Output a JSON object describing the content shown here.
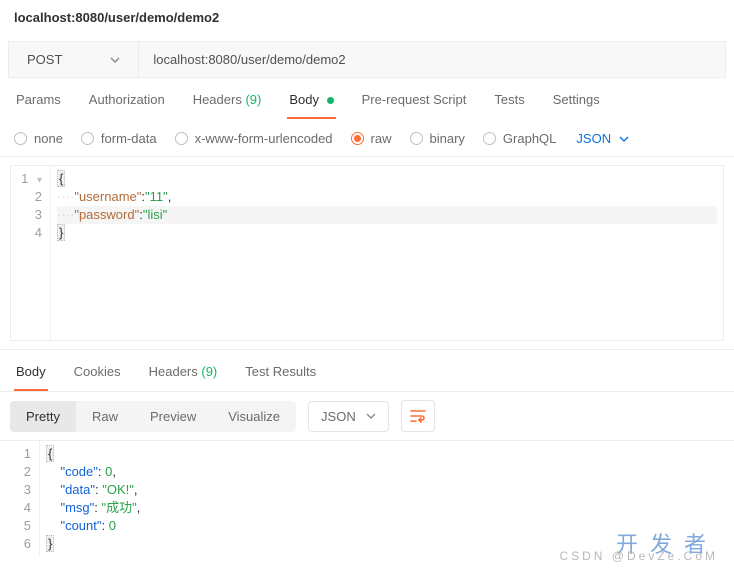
{
  "topbar": {
    "title": "localhost:8080/user/demo/demo2"
  },
  "request": {
    "method": "POST",
    "url": "localhost:8080/user/demo/demo2"
  },
  "tabs": {
    "params": "Params",
    "auth": "Authorization",
    "headers": "Headers",
    "headers_count": "(9)",
    "body": "Body",
    "prereq": "Pre-request Script",
    "tests": "Tests",
    "settings": "Settings"
  },
  "body_types": {
    "none": "none",
    "formdata": "form-data",
    "xwww": "x-www-form-urlencoded",
    "raw": "raw",
    "binary": "binary",
    "graphql": "GraphQL",
    "json": "JSON"
  },
  "req_body": {
    "l1": "{",
    "l2_ws": "····",
    "l2_k": "\"username\"",
    "l2_c": ":",
    "l2_v": "\"11\"",
    "l2_e": ",",
    "l3_ws": "····",
    "l3_k": "\"password\"",
    "l3_c": ":",
    "l3_v": "\"lisi\"",
    "l4": "}"
  },
  "resp_tabs": {
    "body": "Body",
    "cookies": "Cookies",
    "headers": "Headers",
    "headers_count": "(9)",
    "results": "Test Results"
  },
  "resp_ctrl": {
    "pretty": "Pretty",
    "raw": "Raw",
    "preview": "Preview",
    "visualize": "Visualize",
    "json": "JSON"
  },
  "resp_body": {
    "l1": "{",
    "l2_ws": "    ",
    "l2_k": "\"code\"",
    "l2_v": "0",
    "l3_ws": "    ",
    "l3_k": "\"data\"",
    "l3_v": "\"OK!\"",
    "l4_ws": "    ",
    "l4_k": "\"msg\"",
    "l4_v": "\"成功\"",
    "l5_ws": "    ",
    "l5_k": "\"count\"",
    "l5_v": "0",
    "l6": "}",
    "colon": ": ",
    "comma": ","
  },
  "watermark": {
    "big": "开发者",
    "small": "CSDN @DevZe.CoM"
  }
}
